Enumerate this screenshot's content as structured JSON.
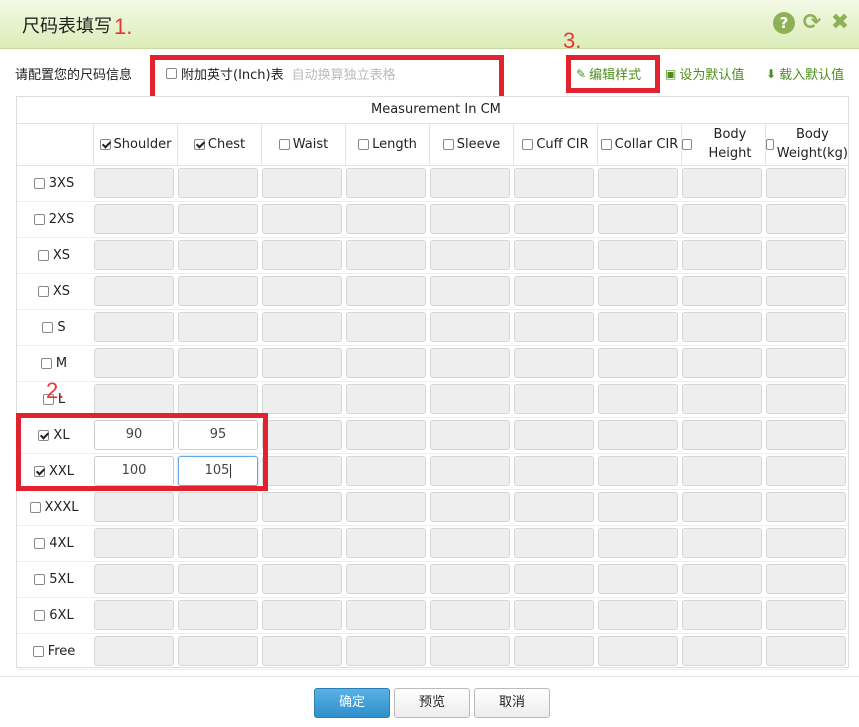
{
  "window": {
    "title": "尺码表填写"
  },
  "annotations": {
    "one": "1.",
    "two": "2.",
    "three": "3."
  },
  "colors": {
    "accent_green": "#8fb155",
    "annotation_red": "#e0232f",
    "primary_blue": "#2f8fcb"
  },
  "toolbar_icons": [
    "help-icon",
    "refresh-icon",
    "close-icon"
  ],
  "config": {
    "label": "请配置您的尺码信息",
    "inch_checkbox_label": "附加英寸(Inch)表",
    "inch_hint": "自动换算独立表格",
    "inch_checked": false
  },
  "actions": {
    "edit_style": "编辑样式",
    "set_default": "设为默认值",
    "load_default": "载入默认值"
  },
  "table": {
    "measurement_label": "Measurement In CM",
    "columns": [
      {
        "label": "Shoulder",
        "checked": true
      },
      {
        "label": "Chest",
        "checked": true
      },
      {
        "label": "Waist",
        "checked": false
      },
      {
        "label": "Length",
        "checked": false
      },
      {
        "label": "Sleeve",
        "checked": false
      },
      {
        "label": "Cuff CIR",
        "checked": false
      },
      {
        "label": "Collar CIR",
        "checked": false
      },
      {
        "label": "Body Height",
        "checked": false
      },
      {
        "label": "Body Weight(kg)",
        "checked": false
      }
    ],
    "rows": [
      {
        "size": "3XS",
        "checked": false,
        "values": []
      },
      {
        "size": "2XS",
        "checked": false,
        "values": []
      },
      {
        "size": "XS",
        "checked": false,
        "values": []
      },
      {
        "size": "XS",
        "checked": false,
        "values": []
      },
      {
        "size": "S",
        "checked": false,
        "values": []
      },
      {
        "size": "M",
        "checked": false,
        "values": []
      },
      {
        "size": "L",
        "checked": false,
        "values": []
      },
      {
        "size": "XL",
        "checked": true,
        "values": [
          "90",
          "95"
        ]
      },
      {
        "size": "XXL",
        "checked": true,
        "values": [
          "100",
          "105"
        ]
      },
      {
        "size": "XXXL",
        "checked": false,
        "values": []
      },
      {
        "size": "4XL",
        "checked": false,
        "values": []
      },
      {
        "size": "5XL",
        "checked": false,
        "values": []
      },
      {
        "size": "6XL",
        "checked": false,
        "values": []
      },
      {
        "size": "Free",
        "checked": false,
        "values": []
      }
    ]
  },
  "footer": {
    "confirm": "确定",
    "preview": "预览",
    "cancel": "取消"
  }
}
